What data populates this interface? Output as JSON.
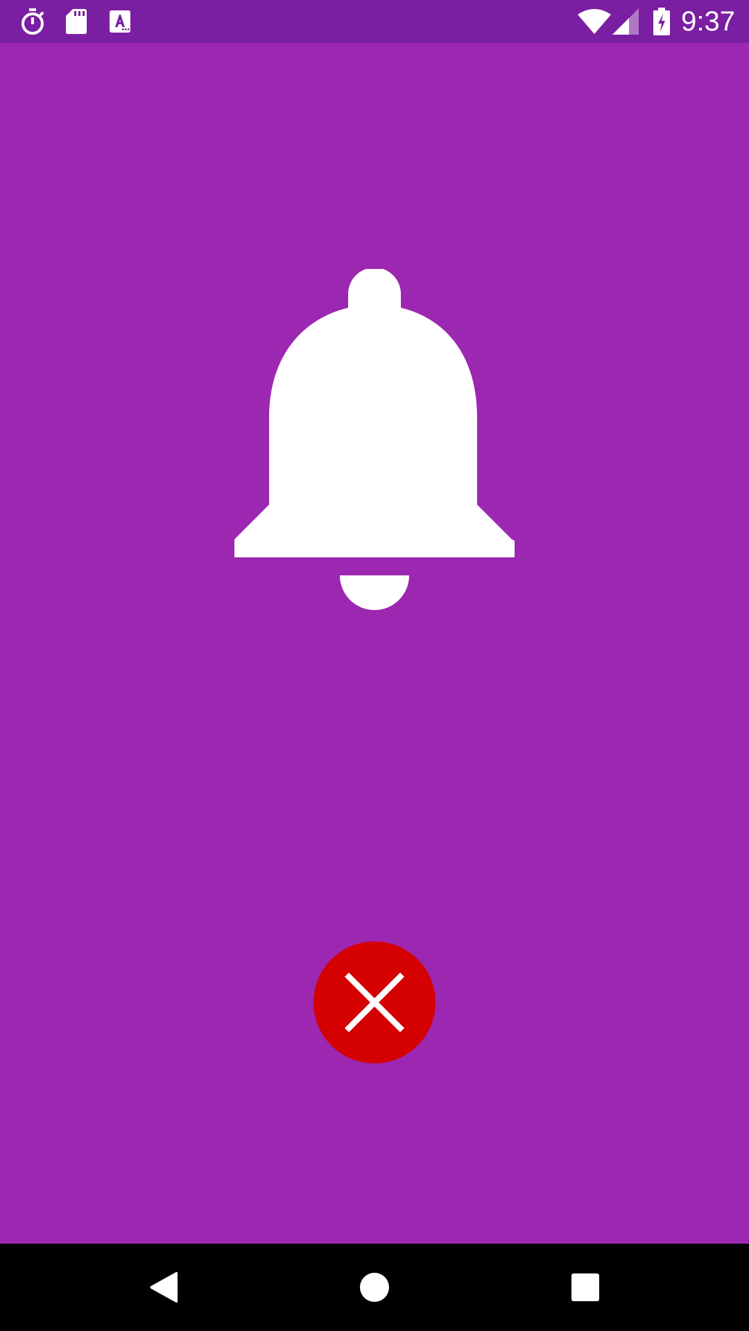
{
  "status_bar": {
    "time": "9:37",
    "left_icons": [
      "timer-icon",
      "sd-card-icon",
      "font-app-icon"
    ],
    "right_icons": [
      "wifi-icon",
      "cell-signal-icon",
      "battery-charging-icon"
    ]
  },
  "alarm": {
    "icon": "bell-icon"
  },
  "dismiss_button": {
    "icon": "close-icon"
  },
  "nav_bar": {
    "buttons": [
      "back-icon",
      "home-icon",
      "recents-icon"
    ]
  },
  "colors": {
    "background": "#9c27b0",
    "status_bar": "#7b1fa2",
    "dismiss": "#d50000",
    "nav_bar": "#000000",
    "foreground": "#ffffff"
  }
}
